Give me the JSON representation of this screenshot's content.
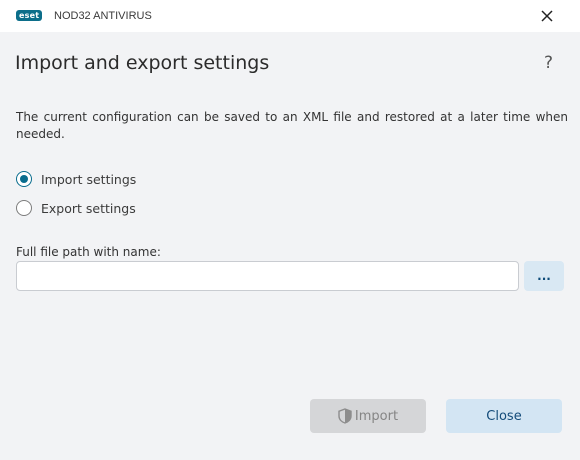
{
  "window": {
    "brand": "eset",
    "product": "NOD32 ANTIVIRUS"
  },
  "header": {
    "title": "Import and export settings",
    "help": "?"
  },
  "main": {
    "description": "The current configuration can be saved to an XML file and restored at a later time when needed.",
    "options": [
      {
        "label": "Import settings",
        "selected": true
      },
      {
        "label": "Export settings",
        "selected": false
      }
    ],
    "path_label": "Full file path with name:",
    "path_value": "",
    "browse_label": "..."
  },
  "footer": {
    "import_label": "Import",
    "import_enabled": false,
    "close_label": "Close"
  },
  "colors": {
    "accent": "#0a6d8e",
    "background": "#f2f3f5"
  }
}
